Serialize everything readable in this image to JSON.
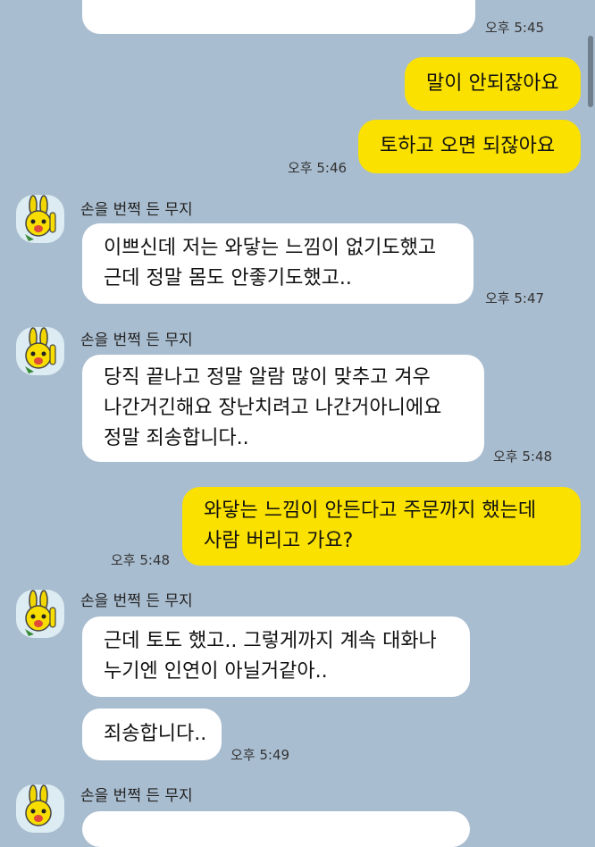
{
  "time_top": "오후 5:45",
  "sender_name": "손을 번쩍 든 무지",
  "messages": {
    "m1": "말이 안되잖아요",
    "m2": "토하고 오면 되잖아요",
    "t2": "오후 5:46",
    "m3": [
      "이쁘신데 저는 와닿는 느낌이 없기도했고",
      "근데 정말 몸도 안좋기도했고.."
    ],
    "t3": "오후 5:47",
    "m4": [
      "당직 끝나고 정말 알람 많이 맞추고 겨우",
      "나간거긴해요 장난치려고 나간거아니에요",
      "정말 죄송합니다.."
    ],
    "t4": "오후 5:48",
    "m5": [
      "와닿는 느낌이 안든다고 주문까지 했는데",
      "사람 버리고 가요?"
    ],
    "t5": "오후 5:48",
    "m6": [
      "근데 토도 했고.. 그렇게까지 계속 대화나",
      "누기엔 인연이 아닐거같아.."
    ],
    "m7": "죄송합니다..",
    "t7": "오후 5:49"
  },
  "colors": {
    "background": "#a9bdd0",
    "my_bubble": "#fae100",
    "their_bubble": "#ffffff"
  },
  "icons": {
    "avatar": "muzi-rabbit-icon"
  }
}
